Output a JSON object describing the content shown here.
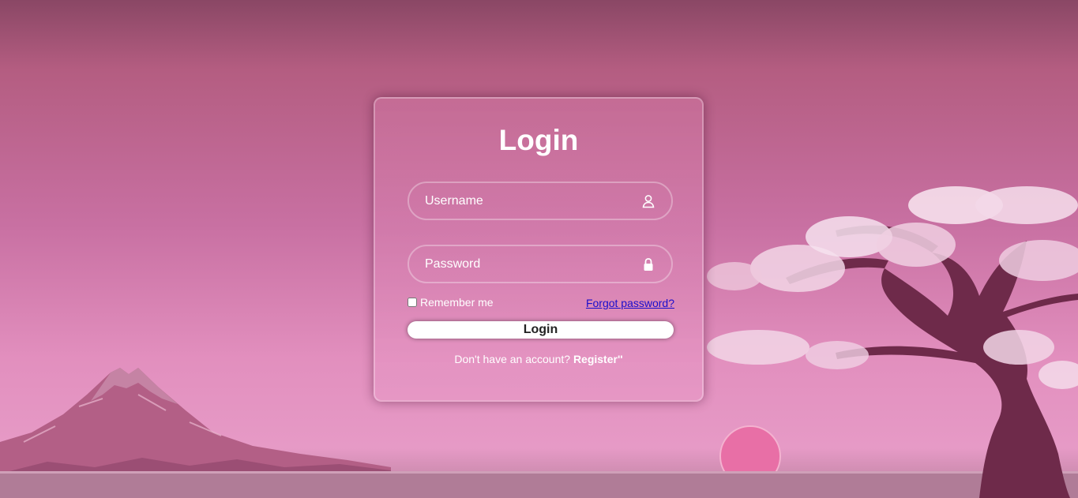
{
  "login": {
    "title": "Login",
    "username": {
      "placeholder": "Username",
      "value": "",
      "icon": "user-icon"
    },
    "password": {
      "placeholder": "Password",
      "value": "",
      "icon": "lock-icon"
    },
    "remember_label": "Remember me",
    "remember_checked": false,
    "forgot_label": "Forgot password?",
    "submit_label": "Login",
    "no_account_text": "Don't have an account?",
    "register_label": "Register''"
  },
  "colors": {
    "background_top": "#8a4765",
    "background_mid": "#c870a2",
    "background_bottom": "#e69ac6",
    "link": "#1a0dcc",
    "text": "#ffffff"
  }
}
